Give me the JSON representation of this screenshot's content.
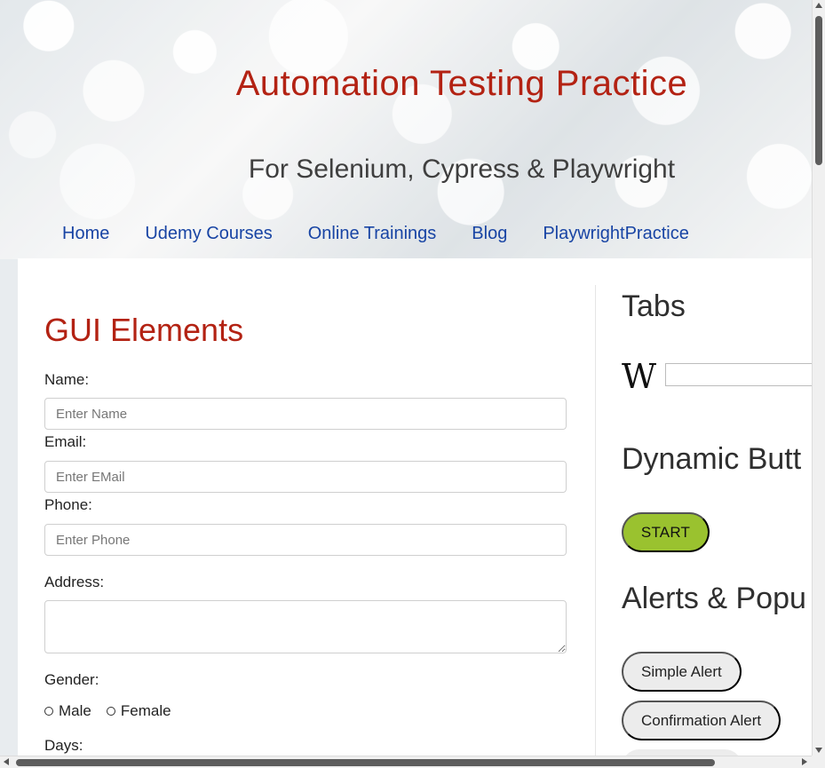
{
  "header": {
    "title": "Automation Testing Practice",
    "subtitle": "For Selenium, Cypress & Playwright"
  },
  "nav": {
    "items": [
      {
        "label": "Home"
      },
      {
        "label": "Udemy Courses"
      },
      {
        "label": "Online Trainings"
      },
      {
        "label": "Blog"
      },
      {
        "label": "PlaywrightPractice"
      }
    ]
  },
  "gui": {
    "title": "GUI Elements",
    "name_label": "Name:",
    "name_placeholder": "Enter Name",
    "email_label": "Email:",
    "email_placeholder": "Enter EMail",
    "phone_label": "Phone:",
    "phone_placeholder": "Enter Phone",
    "address_label": "Address:",
    "gender_label": "Gender:",
    "male_label": "Male",
    "female_label": "Female",
    "days_label": "Days:"
  },
  "right": {
    "tabs_title": "Tabs",
    "wiki_icon": "W",
    "dynamic_title": "Dynamic Butt",
    "start_label": "START",
    "alerts_title": "Alerts & Popu",
    "simple_alert": "Simple Alert",
    "confirmation_alert": "Confirmation Alert"
  },
  "colors": {
    "accent_red": "#b32213",
    "nav_blue": "#1844a4",
    "start_green": "#9ac22f"
  }
}
